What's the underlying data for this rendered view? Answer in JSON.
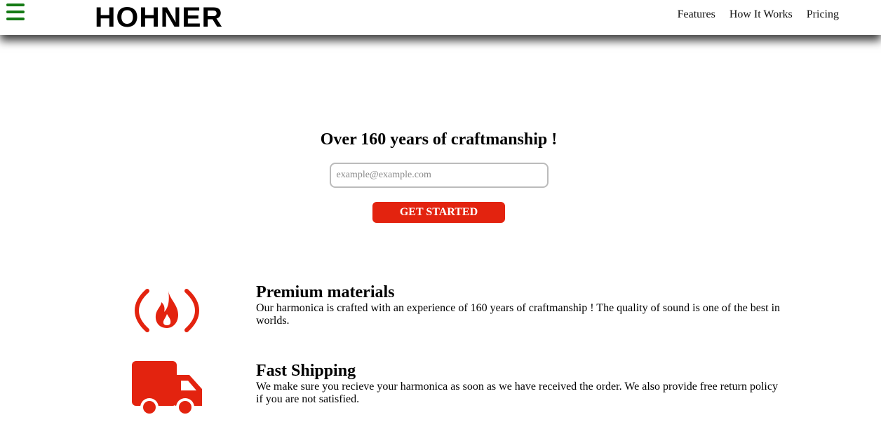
{
  "header": {
    "brand": "HOHNER",
    "nav": [
      "Features",
      "How It Works",
      "Pricing"
    ]
  },
  "hero": {
    "title": "Over 160 years of craftmanship !",
    "email_placeholder": "example@example.com",
    "cta_label": "GET STARTED"
  },
  "features": [
    {
      "icon": "fire-icon",
      "title": "Premium materials",
      "text": "Our harmonica is crafted with an experience of 160 years of craftmanship ! The quality of sound is one of the best in worlds."
    },
    {
      "icon": "truck-icon",
      "title": "Fast Shipping",
      "text": "We make sure you recieve your harmonica as soon as we have received the order. We also provide free return policy if you are not satisfied."
    }
  ],
  "colors": {
    "accent": "#e3230f",
    "menu_icon": "#157a15"
  }
}
